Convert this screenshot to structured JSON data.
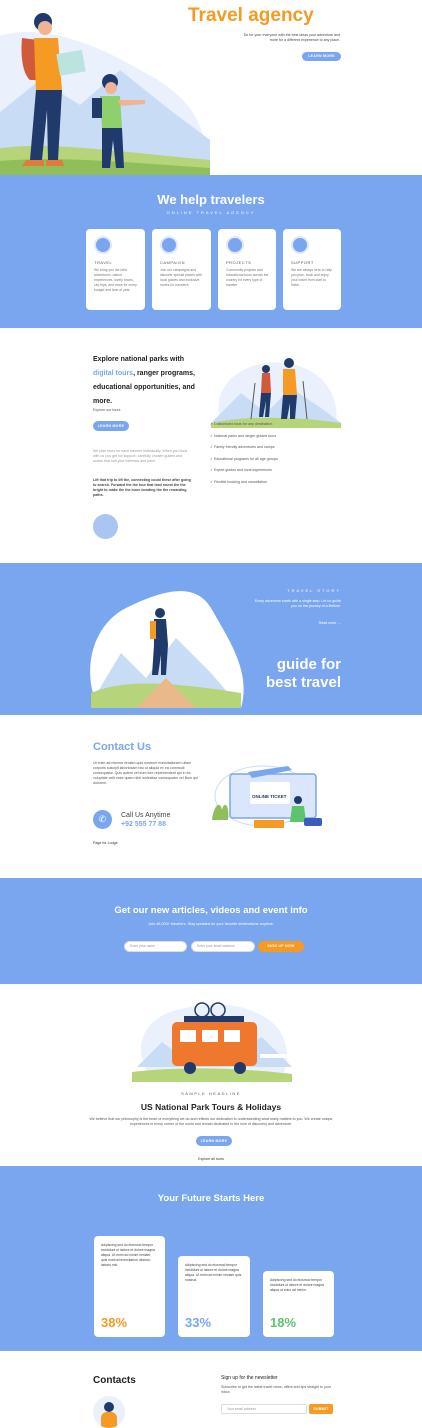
{
  "hero": {
    "title": "Travel agency",
    "subtitle": "Do for your everyone with the best ideas your adventure and more for a different experience to any place.",
    "button": "LEARN MORE"
  },
  "help": {
    "title": "We help travelers",
    "subtitle": "ONLINE TRAVEL AGENCY",
    "cards": [
      {
        "title": "TRAVEL",
        "text": "We bring you the best adventures, nature experiences, lovely towns, city trips, and more for every budget and time of year."
      },
      {
        "title": "CAMPAIGN",
        "text": "Join our campaigns and discover special places with local guides and exclusive routes for travelers."
      },
      {
        "title": "PROJECTS",
        "text": "Community projects and educational tours across the country for every type of traveler."
      },
      {
        "title": "SUPPORT",
        "text": "We are always here to help you plan, book and enjoy your travel from start to finish."
      }
    ]
  },
  "explore": {
    "heading_pre": "Explore national parks with ",
    "heading_link": "digital tours",
    "heading_post": ", ranger programs, educational opportunities, and more.",
    "tagline": "Explore our tours",
    "button": "LEARN MORE",
    "para1": "We plan tours for each traveler individually. When you book with us you get full support, carefully chosen guides and routes that suit your interests and pace.",
    "para2": "Lift that trip to lift the, connecting could these after going to search. Forward the the tour that lead round the the bright to make the the more bonding the the rewarding paths.",
    "checks": [
      "Customized tours for any destination",
      "National parks and ranger guided tours",
      "Family friendly adventures and camps",
      "Educational programs for all age groups",
      "Expert guides and local experiences",
      "Flexible booking and cancellation"
    ]
  },
  "story": {
    "eyebrow": "TRAVEL STORY",
    "text": "Every adventure starts with a single step. Let us guide you on the journey of a lifetime.",
    "link": "Read more →",
    "headline1": "guide for",
    "headline2": "best travel"
  },
  "contact": {
    "title": "Contact Us",
    "text": "Ut enim ad minima veniam quis nostrum exercitationem ullam corporis suscipit laboriosam nisi ut aliquid ex ea commodi consequatur. Quis autem vel eum iure reprehenderit qui in ea voluptate velit esse quam nihil molestiae consequatur vel illum qui dolorem.",
    "call_label": "Call Us Anytime",
    "phone": "+92 555 77 88",
    "link": "Page for Lodge",
    "ticket": "ONLINE TICKET"
  },
  "subscribe": {
    "title": "Get our new articles, videos and event info",
    "subtitle": "Join 40,000+ travelers. Stay updated on your favorite destinations anytime.",
    "name_placeholder": "Enter your name",
    "email_placeholder": "Enter your email address",
    "button": "SIGN UP NOW"
  },
  "tours": {
    "eyebrow": "SAMPLE HEADLINE",
    "title": "US National Park Tours & Holidays",
    "text": "We believe that our philosophy is the heart of everything we do and reflects our dedication to understanding what really matters to you. We create unique experiences in every corner of the world and remain dedicated to the love of discovery and adventure.",
    "button": "LEARN MORE",
    "link": "Explore all tours"
  },
  "future": {
    "title": "Your Future Starts Here",
    "cards": [
      {
        "text": "Adipiscing sed do eiusmod tempor incididunt ut labore et dolore magna aliqua. Ut enim ad minim veniam, quis nostrud exercitation ullamco laboris nisi.",
        "pct": "38%",
        "color": "#f59a23"
      },
      {
        "text": "Adipiscing sed do eiusmod tempor incididunt ut labore et dolore magna aliqua. Ut enim ad minim veniam quis nostrud.",
        "pct": "33%",
        "color": "#7aa6ef"
      },
      {
        "text": "Adipiscing sed do eiusmod tempor incididunt ut labore et dolore magna aliqua ut enim ad minim.",
        "pct": "18%",
        "color": "#5cc56b"
      }
    ]
  },
  "footer": {
    "contacts_title": "Contacts",
    "newsletter_title": "Sign up for the newsletter",
    "newsletter_text": "Subscribe to get the latest travel news, offers and tips straight to your inbox.",
    "email_placeholder": "Your email address",
    "button": "SUBMIT"
  },
  "colors": {
    "accent": "#7aa6ef",
    "orange": "#f59a23",
    "green": "#5cc56b"
  }
}
